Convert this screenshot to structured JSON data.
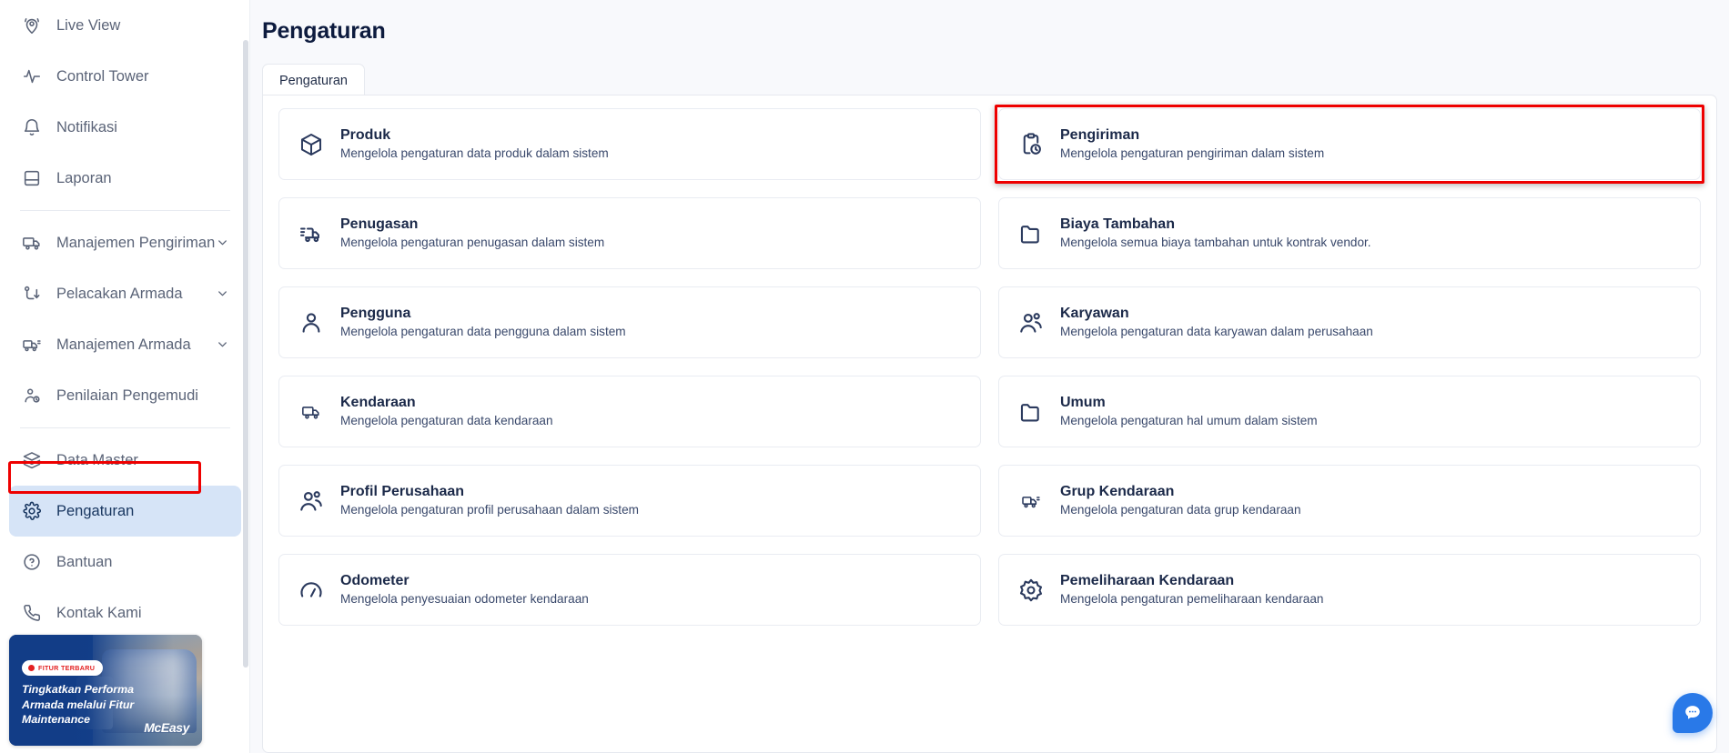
{
  "sidebar": {
    "items": [
      {
        "label": "Live View",
        "icon": "live-view-icon",
        "expandable": false,
        "active": false
      },
      {
        "label": "Control Tower",
        "icon": "activity-icon",
        "expandable": false,
        "active": false
      },
      {
        "label": "Notifikasi",
        "icon": "bell-icon",
        "expandable": false,
        "active": false
      },
      {
        "label": "Laporan",
        "icon": "report-book-icon",
        "expandable": false,
        "active": false
      },
      {
        "label": "Manajemen Pengiriman",
        "icon": "truck-icon",
        "expandable": true,
        "active": false
      },
      {
        "label": "Pelacakan Armada",
        "icon": "route-pin-icon",
        "expandable": true,
        "active": false
      },
      {
        "label": "Manajemen Armada",
        "icon": "fleet-truck-icon",
        "expandable": true,
        "active": false
      },
      {
        "label": "Penilaian Pengemudi",
        "icon": "driver-rating-icon",
        "expandable": false,
        "active": false
      },
      {
        "label": "Data Master",
        "icon": "layers-icon",
        "expandable": false,
        "active": false
      },
      {
        "label": "Pengaturan",
        "icon": "gear-icon",
        "expandable": false,
        "active": true
      },
      {
        "label": "Bantuan",
        "icon": "question-circle-icon",
        "expandable": false,
        "active": false
      },
      {
        "label": "Kontak Kami",
        "icon": "phone-icon",
        "expandable": false,
        "active": false
      }
    ],
    "promo": {
      "badge": "FITUR TERBARU",
      "title": "Tingkatkan Performa Armada melalui Fitur Maintenance",
      "logo": "McEasy"
    }
  },
  "header": {
    "title": "Pengaturan"
  },
  "tabs": [
    {
      "label": "Pengaturan",
      "active": true
    }
  ],
  "cards": [
    {
      "title": "Produk",
      "desc": "Mengelola pengaturan data produk dalam sistem",
      "icon": "box-icon",
      "highlighted": false
    },
    {
      "title": "Pengiriman",
      "desc": "Mengelola pengaturan pengiriman dalam sistem",
      "icon": "clipboard-clock-icon",
      "highlighted": true
    },
    {
      "title": "Penugasan",
      "desc": "Mengelola pengaturan penugasan dalam sistem",
      "icon": "delivery-truck-icon",
      "highlighted": false
    },
    {
      "title": "Biaya Tambahan",
      "desc": "Mengelola semua biaya tambahan untuk kontrak vendor.",
      "icon": "folder-icon",
      "highlighted": false
    },
    {
      "title": "Pengguna",
      "desc": "Mengelola pengaturan data pengguna dalam sistem",
      "icon": "user-icon",
      "highlighted": false
    },
    {
      "title": "Karyawan",
      "desc": "Mengelola pengaturan data karyawan dalam perusahaan",
      "icon": "users-icon",
      "highlighted": false
    },
    {
      "title": "Kendaraan",
      "desc": "Mengelola pengaturan data kendaraan",
      "icon": "truck-icon",
      "highlighted": false
    },
    {
      "title": "Umum",
      "desc": "Mengelola pengaturan hal umum dalam sistem",
      "icon": "folder-icon",
      "highlighted": false
    },
    {
      "title": "Profil Perusahaan",
      "desc": "Mengelola pengaturan profil perusahaan dalam sistem",
      "icon": "users-icon",
      "highlighted": false
    },
    {
      "title": "Grup Kendaraan",
      "desc": "Mengelola pengaturan data grup kendaraan",
      "icon": "fleet-truck-icon",
      "highlighted": false
    },
    {
      "title": "Odometer",
      "desc": "Mengelola penyesuaian odometer kendaraan",
      "icon": "gauge-icon",
      "highlighted": false
    },
    {
      "title": "Pemeliharaan Kendaraan",
      "desc": "Mengelola pengaturan pemeliharaan kendaraan",
      "icon": "maintenance-gear-icon",
      "highlighted": false
    }
  ],
  "fab": {
    "icon": "chat-bubble-icon"
  },
  "colors": {
    "highlight": "#ee0000",
    "accent": "#2979e8",
    "active_nav_bg": "#d6e4f7",
    "title": "#0d1b3e",
    "page_bg": "#f8f9fc"
  }
}
